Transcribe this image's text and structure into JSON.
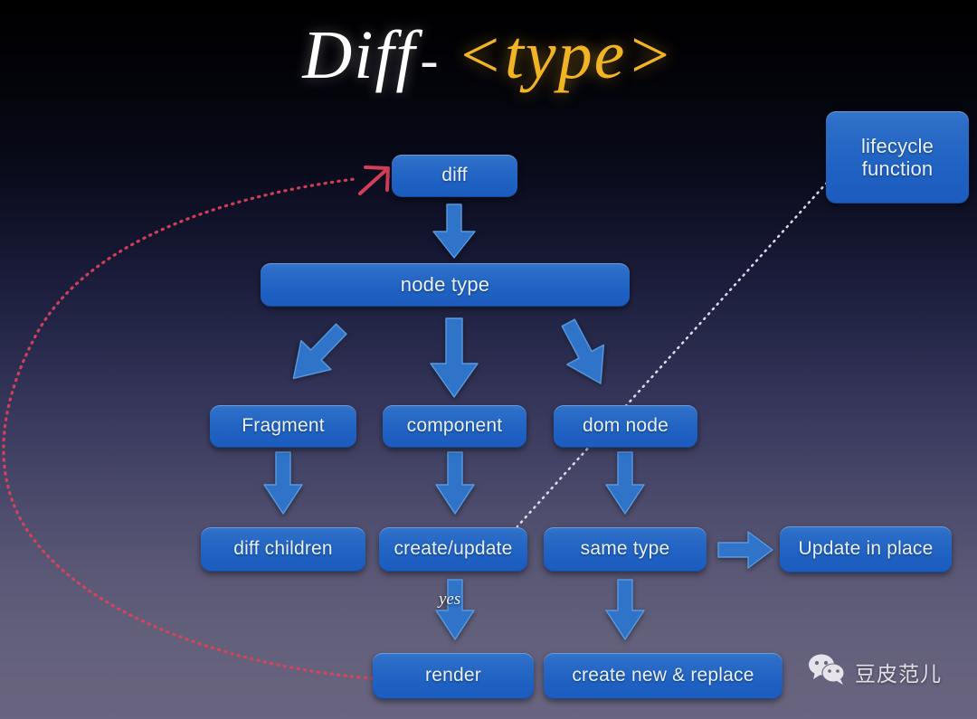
{
  "slide": {
    "title": {
      "main": "Diff",
      "dash": "-",
      "type": "<type>"
    },
    "background_top_color": "#000000",
    "background_bottom_color": "#696580",
    "box_color": "#2a6cc6",
    "arrow_color": "#2f74c9",
    "title_main_color": "#ffffff",
    "title_type_color": "#f1b425"
  },
  "nodes": {
    "diff": "diff",
    "node_type": "node type",
    "fragment": "Fragment",
    "component": "component",
    "dom_node": "dom node",
    "diff_children": "diff children",
    "create_update": "create/update",
    "same_type": "same type",
    "update_in_place": "Update in place",
    "render": "render",
    "create_new_replace": "create new & replace",
    "lifecycle_line1": "lifecycle",
    "lifecycle_line2": "function"
  },
  "labels": {
    "yes": "yes"
  },
  "connectors": {
    "red_loop": {
      "color": "#e0415a",
      "style": "dotted",
      "from": "render",
      "to": "diff"
    },
    "white_dotted": {
      "color": "#e8e2f2",
      "style": "dotted",
      "from": "lifecycle function",
      "to": "create/update"
    }
  },
  "watermark": {
    "icon": "wechat-icon",
    "text": "豆皮范儿"
  }
}
